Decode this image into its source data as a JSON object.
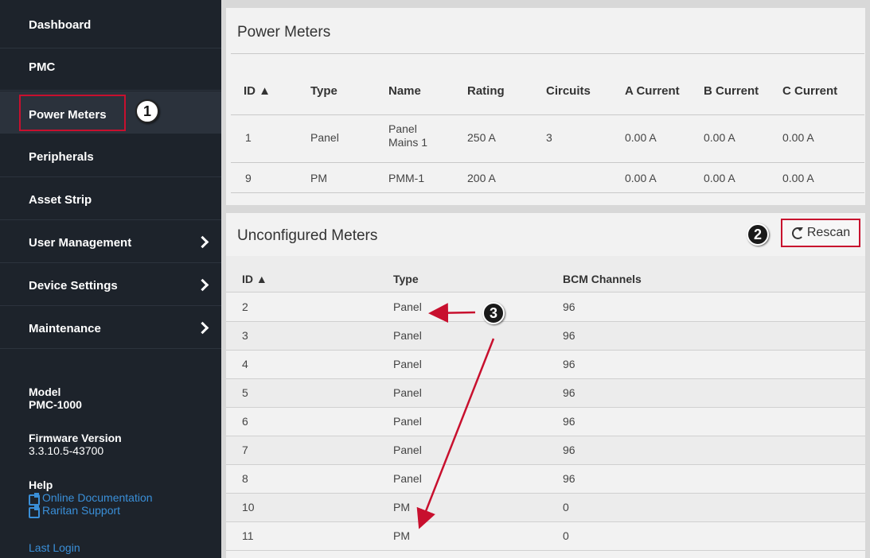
{
  "sidebar": {
    "items": [
      {
        "label": "Dashboard",
        "has_submenu": false
      },
      {
        "label": "PMC",
        "has_submenu": false
      },
      {
        "label": "Power Meters",
        "has_submenu": false,
        "active": true
      },
      {
        "label": "Peripherals",
        "has_submenu": false
      },
      {
        "label": "Asset Strip",
        "has_submenu": false
      },
      {
        "label": "User Management",
        "has_submenu": true
      },
      {
        "label": "Device Settings",
        "has_submenu": true
      },
      {
        "label": "Maintenance",
        "has_submenu": true
      }
    ],
    "model_label": "Model",
    "model_value": "PMC-1000",
    "firmware_label": "Firmware Version",
    "firmware_value": "3.3.10.5-43700",
    "help_label": "Help",
    "links": [
      "Online Documentation",
      "Raritan Support"
    ],
    "last_login_label": "Last Login"
  },
  "power_meters": {
    "title": "Power Meters",
    "columns": [
      "ID ▲",
      "Type",
      "Name",
      "Rating",
      "Circuits",
      "A Current",
      "B Current",
      "C Current"
    ],
    "rows": [
      {
        "id": "1",
        "type": "Panel",
        "name_line1": "Panel",
        "name_line2": "Mains 1",
        "rating": "250 A",
        "circuits": "3",
        "a": "0.00 A",
        "b": "0.00 A",
        "c": "0.00 A"
      },
      {
        "id": "9",
        "type": "PM",
        "name_line1": "PMM-1",
        "name_line2": "",
        "rating": "200 A",
        "circuits": "",
        "a": "0.00 A",
        "b": "0.00 A",
        "c": "0.00 A"
      }
    ]
  },
  "unconfigured_meters": {
    "title": "Unconfigured Meters",
    "rescan_label": "Rescan",
    "columns": [
      "ID ▲",
      "Type",
      "BCM Channels"
    ],
    "rows": [
      {
        "id": "2",
        "type": "Panel",
        "bcm": "96"
      },
      {
        "id": "3",
        "type": "Panel",
        "bcm": "96"
      },
      {
        "id": "4",
        "type": "Panel",
        "bcm": "96"
      },
      {
        "id": "5",
        "type": "Panel",
        "bcm": "96"
      },
      {
        "id": "6",
        "type": "Panel",
        "bcm": "96"
      },
      {
        "id": "7",
        "type": "Panel",
        "bcm": "96"
      },
      {
        "id": "8",
        "type": "Panel",
        "bcm": "96"
      },
      {
        "id": "10",
        "type": "PM",
        "bcm": "0"
      },
      {
        "id": "11",
        "type": "PM",
        "bcm": "0"
      }
    ]
  },
  "callouts": [
    "1",
    "2",
    "3"
  ],
  "colors": {
    "sidebar_bg": "#1d232b",
    "highlight": "#c8102e",
    "link": "#3a8fd8",
    "panel_bg": "#f2f2f2"
  }
}
